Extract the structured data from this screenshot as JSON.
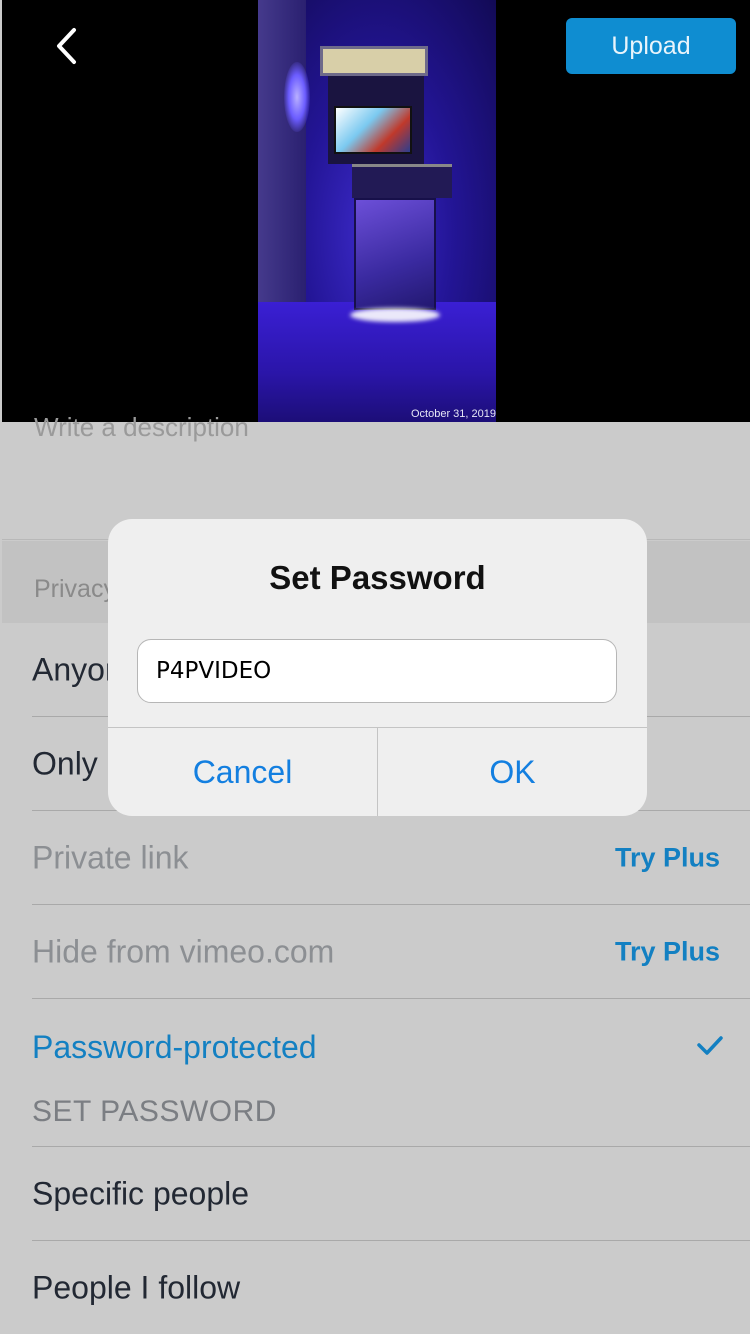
{
  "header": {
    "back_icon": "chevron-left-icon",
    "upload_label": "Upload",
    "upload_color": "#0f8dd1"
  },
  "preview": {
    "date": "October 31, 2019"
  },
  "form": {
    "description_placeholder": "Write a description",
    "privacy_header": "Privacy",
    "options": [
      {
        "label": "Anyone"
      },
      {
        "label": "Only me"
      },
      {
        "label": "Private link",
        "badge": "Try Plus"
      },
      {
        "label": "Hide from vimeo.com",
        "badge": "Try Plus"
      },
      {
        "label": "Password-protected",
        "sub": "SET PASSWORD",
        "selected": true
      },
      {
        "label": "Specific people"
      },
      {
        "label": "People I follow"
      }
    ],
    "accent_color": "#1380c2"
  },
  "dialog": {
    "title": "Set Password",
    "password_value": "P4PVIDEO",
    "cancel_label": "Cancel",
    "ok_label": "OK",
    "button_color": "#137fe0"
  }
}
